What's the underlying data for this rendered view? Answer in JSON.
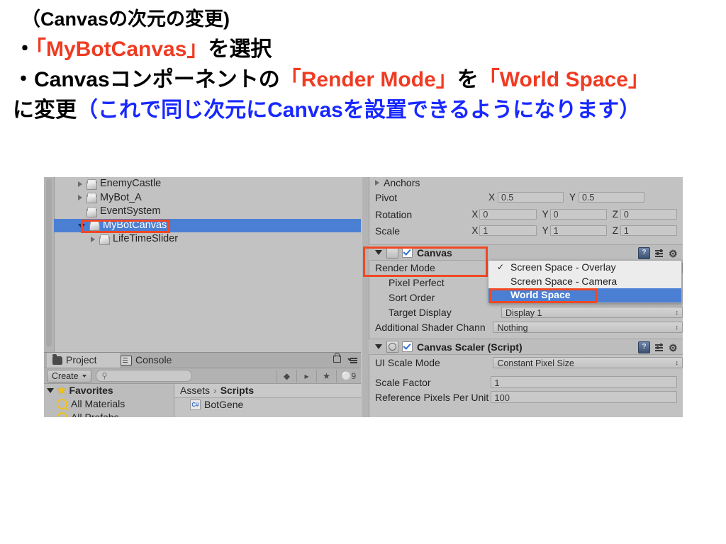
{
  "slide": {
    "line1": "（Canvasの次元の変更)",
    "line2_bullet": "・",
    "line2_red": "「MyBotCanvas」",
    "line2_tail": "を選択",
    "line3_bullet": "・Canvasコンポーネントの",
    "line3_red1": "「Render Mode」",
    "line3_mid": "を",
    "line3_red2": "「World Space」",
    "line4_black": "に変更",
    "line4_blue": "（これで同じ次元にCanvasを設置できるようになります）",
    "accent_red": "#ef3b22",
    "accent_blue": "#1828ff",
    "highlight_box_color": "#f04824",
    "selection_blue": "#4b7fd4"
  },
  "hierarchy": {
    "items": [
      {
        "label": "EnemyCastle",
        "indent": 1,
        "arrow": "closed",
        "selected": false
      },
      {
        "label": "MyBot_A",
        "indent": 1,
        "arrow": "closed",
        "selected": false
      },
      {
        "label": "EventSystem",
        "indent": 1,
        "arrow": "none",
        "selected": false
      },
      {
        "label": "MyBotCanvas",
        "indent": 1,
        "arrow": "open",
        "selected": true
      },
      {
        "label": "LifeTimeSlider",
        "indent": 2,
        "arrow": "closed",
        "selected": false
      }
    ]
  },
  "project_panel": {
    "tabs": [
      {
        "label": "Project",
        "icon": "folder-icon",
        "active": true
      },
      {
        "label": "Console",
        "icon": "console-icon",
        "active": false
      }
    ],
    "create_button": "Create",
    "search_placeholder": "",
    "toolbar_icons": [
      "filter-by-type-icon",
      "filter-by-label-icon",
      "favorite-star-icon",
      "hidden-packages-icon"
    ],
    "hidden_count": "9",
    "favorites": {
      "header": "Favorites",
      "items": [
        "All Materials",
        "All Prefabs"
      ]
    },
    "breadcrumb": {
      "root": "Assets",
      "separator": "›",
      "current": "Scripts"
    },
    "assets": [
      {
        "label": "BotGene",
        "icon": "csharp-script-icon"
      }
    ]
  },
  "inspector": {
    "rect_transform": {
      "anchors_label": "Anchors",
      "rows": [
        {
          "label": "Pivot",
          "fields": [
            {
              "axis": "X",
              "value": "0.5"
            },
            {
              "axis": "Y",
              "value": "0.5"
            }
          ]
        },
        {
          "label": "Rotation",
          "fields": [
            {
              "axis": "X",
              "value": "0"
            },
            {
              "axis": "Y",
              "value": "0"
            },
            {
              "axis": "Z",
              "value": "0"
            }
          ]
        },
        {
          "label": "Scale",
          "fields": [
            {
              "axis": "X",
              "value": "1"
            },
            {
              "axis": "Y",
              "value": "1"
            },
            {
              "axis": "Z",
              "value": "1"
            }
          ]
        }
      ]
    },
    "canvas_component": {
      "title": "Canvas",
      "enabled": true,
      "header_icons": [
        "help-icon",
        "preset-icon",
        "gear-icon"
      ],
      "rows": [
        {
          "label": "Render Mode",
          "type": "dropdown",
          "value": ""
        },
        {
          "label": "Pixel Perfect",
          "type": "toggle",
          "value": ""
        },
        {
          "label": "Sort Order",
          "type": "field",
          "value": ""
        },
        {
          "label": "Target Display",
          "type": "dropdown",
          "value": "Display 1"
        },
        {
          "label": "Additional Shader Chann",
          "type": "dropdown",
          "value": "Nothing"
        }
      ]
    },
    "render_mode_popup": {
      "options": [
        {
          "label": "Screen Space - Overlay",
          "checked": true,
          "highlighted": false
        },
        {
          "label": "Screen Space - Camera",
          "checked": false,
          "highlighted": false
        },
        {
          "label": "World Space",
          "checked": false,
          "highlighted": true
        }
      ]
    },
    "canvas_scaler_component": {
      "title": "Canvas Scaler (Script)",
      "enabled": true,
      "header_icons": [
        "help-icon",
        "preset-icon",
        "gear-icon"
      ],
      "rows": [
        {
          "label": "UI Scale Mode",
          "type": "dropdown",
          "value": "Constant Pixel Size"
        },
        {
          "label": "Scale Factor",
          "type": "field",
          "value": "1"
        },
        {
          "label": "Reference Pixels Per Unit",
          "type": "field",
          "value": "100"
        }
      ]
    }
  }
}
